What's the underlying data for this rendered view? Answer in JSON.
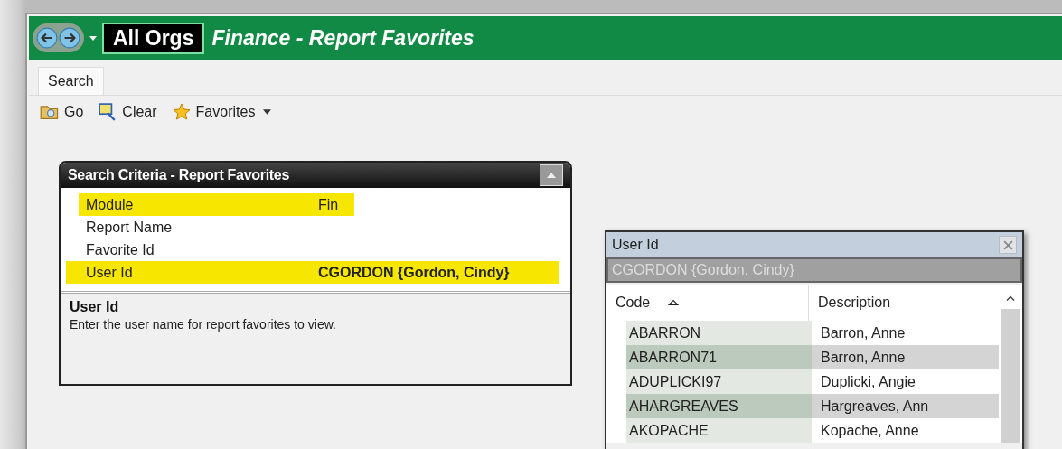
{
  "header": {
    "org": "All Orgs",
    "title": "Finance - Report Favorites"
  },
  "tabs": [
    {
      "label": "Search",
      "selected": true
    }
  ],
  "toolbar": [
    {
      "label": "Go",
      "kind": "go"
    },
    {
      "label": "Clear",
      "kind": "clear"
    },
    {
      "label": "Favorites",
      "kind": "favorites"
    }
  ],
  "criteria_panel": {
    "title": "Search Criteria - Report Favorites",
    "rows": [
      {
        "label": "Module",
        "value": "Fin",
        "highlighted": true,
        "selected": false
      },
      {
        "label": "Report Name",
        "highlighted": false,
        "selected": false
      },
      {
        "label": "Favorite Id",
        "highlighted": false,
        "selected": false
      },
      {
        "label": "User Id",
        "value": "CGORDON {Gordon, Cindy}",
        "highlighted": true,
        "selected": true
      }
    ],
    "help_title": "User Id",
    "help_text": "Enter the user name for report favorites to view."
  },
  "lookup": {
    "title": "User Id",
    "filter_value": "CGORDON {Gordon, Cindy}",
    "columns": [
      "Code",
      "Description"
    ],
    "rows": [
      {
        "code": "ABARRON",
        "description": "Barron, Anne"
      },
      {
        "code": "ABARRON71",
        "description": "Barron, Anne"
      },
      {
        "code": "ADUPLICKI97",
        "description": "Duplicki, Angie"
      },
      {
        "code": "AHARGREAVES",
        "description": "Hargreaves, Ann"
      },
      {
        "code": "AKOPACHE",
        "description": "Kopache, Anne"
      }
    ]
  }
}
